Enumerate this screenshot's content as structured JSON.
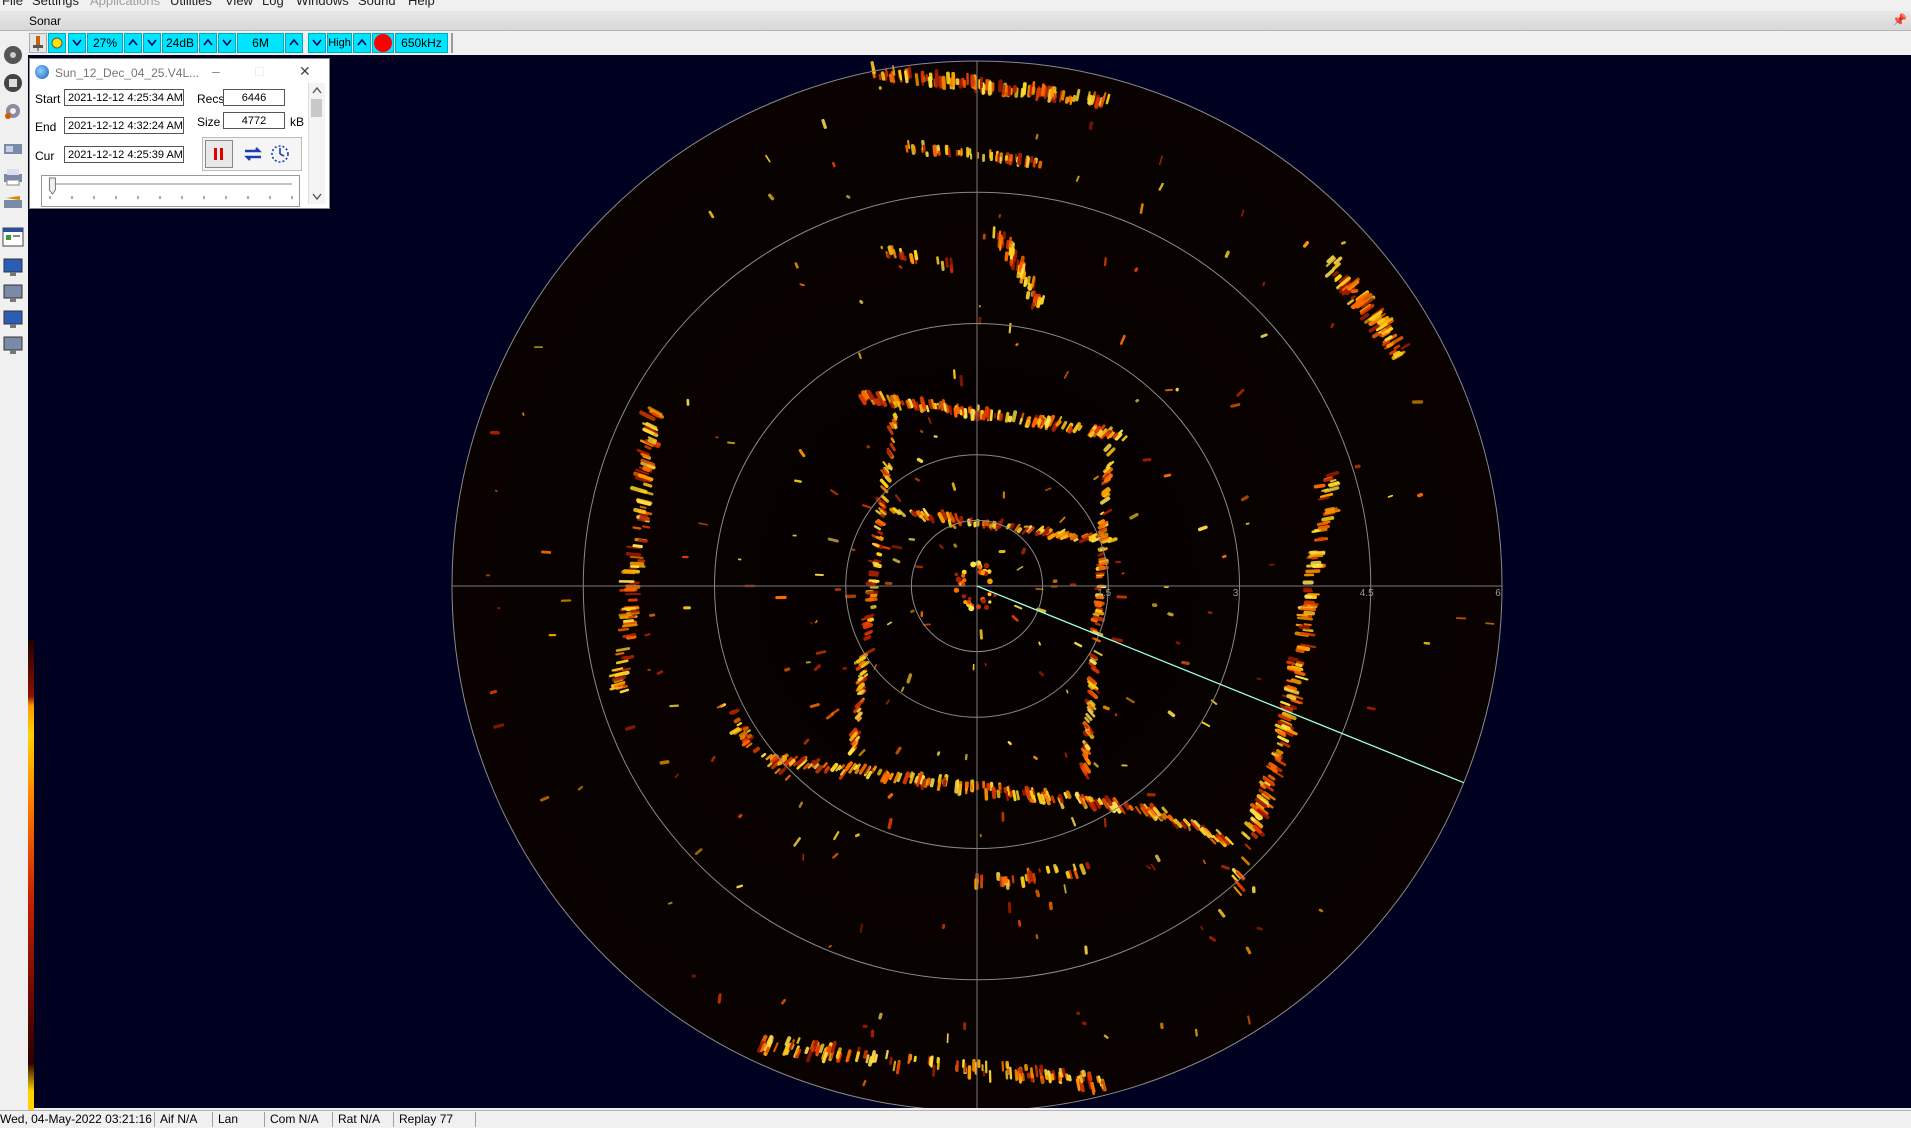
{
  "menu": {
    "items": [
      "File",
      "Settings",
      "Applications",
      "Utilities",
      "View",
      "Log",
      "Windows",
      "Sound",
      "Help"
    ],
    "disabled": [
      "Applications"
    ]
  },
  "window_title": "Sonar",
  "toolbar": {
    "gain_pct": "27%",
    "gain_db": "24dB",
    "range": "6M",
    "resolution": "High",
    "frequency": "650kHz",
    "accent_color": "#00e5ff",
    "record_color": "#ff0000"
  },
  "replay": {
    "filename": "Sun_12_Dec_04_25.V4L...",
    "start_label": "Start",
    "start_value": "2021-12-12 4:25:34 AM",
    "end_label": "End",
    "end_value": "2021-12-12 4:32:24 AM",
    "cur_label": "Cur",
    "cur_value": "2021-12-12 4:25:39 AM",
    "recs_label": "Recs",
    "recs_value": "6446",
    "size_label": "Size",
    "size_value": "4772",
    "size_unit": "kB",
    "position": 0.01
  },
  "sonar": {
    "range_labels": [
      "1.5",
      "3",
      "4.5",
      "6"
    ],
    "background_color": "#000020",
    "scan_line_color": "#9effe0"
  },
  "status": {
    "datetime": "Wed, 04-May-2022 03:21:16",
    "aif": "Aif N/A",
    "lan": "Lan",
    "com": "Com N/A",
    "rat": "Rat N/A",
    "replay": "Replay 77"
  }
}
